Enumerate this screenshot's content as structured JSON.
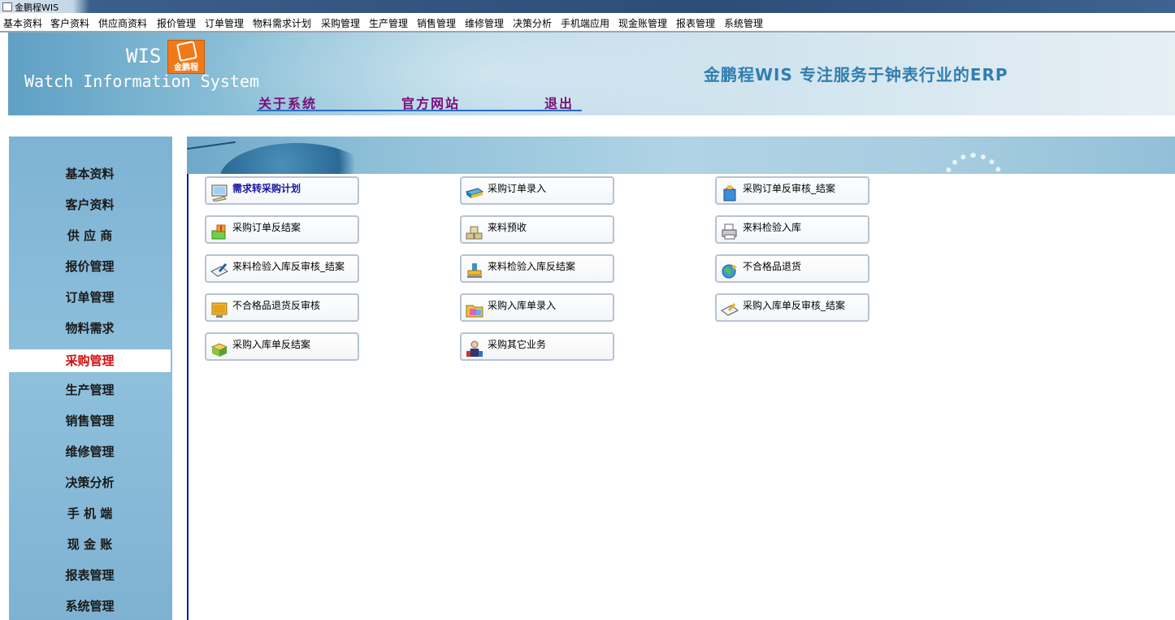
{
  "window": {
    "title": "金鹏程WIS"
  },
  "menubar": [
    "基本资料",
    "客户资料",
    "供应商资料",
    "报价管理",
    "订单管理",
    "物料需求计划",
    "采购管理",
    "生产管理",
    "销售管理",
    "维修管理",
    "决策分析",
    "手机端应用",
    "现金账管理",
    "报表管理",
    "系统管理"
  ],
  "banner": {
    "wis": "WIS",
    "logo_text": "金鹏程",
    "system_name": "Watch Information System",
    "slogan": "金鹏程WIS  专注服务于钟表行业的ERP",
    "links": [
      "关于系统",
      "官方网站",
      "退出"
    ]
  },
  "sidebar": {
    "items": [
      "基本资料",
      "客户资料",
      "供 应 商",
      "报价管理",
      "订单管理",
      "物料需求",
      "采购管理",
      "生产管理",
      "销售管理",
      "维修管理",
      "决策分析",
      "手 机 端",
      "现 金 账",
      "报表管理",
      "系统管理"
    ],
    "active": "采购管理"
  },
  "functions": [
    {
      "label": "需求转采购计划",
      "icon": "monitor-plan-icon"
    },
    {
      "label": "采购订单录入",
      "icon": "laptop-order-icon"
    },
    {
      "label": "采购订单反审核_结案",
      "icon": "shopping-bag-icon"
    },
    {
      "label": "采购订单反结案",
      "icon": "gift-box-icon"
    },
    {
      "label": "来料预收",
      "icon": "stacked-boxes-icon"
    },
    {
      "label": "来料检验入库",
      "icon": "printer-icon"
    },
    {
      "label": "来料检验入库反审核_结案",
      "icon": "notebook-edit-icon"
    },
    {
      "label": "来料检验入库反结案",
      "icon": "stamp-icon"
    },
    {
      "label": "不合格品退货",
      "icon": "globe-return-icon"
    },
    {
      "label": "不合格品退货反审核",
      "icon": "monitor-edit-icon"
    },
    {
      "label": "采购入库单录入",
      "icon": "folder-docs-icon"
    },
    {
      "label": "采购入库单反审核_结案",
      "icon": "book-edit-icon"
    },
    {
      "label": "采购入库单反结案",
      "icon": "package-icon"
    },
    {
      "label": "采购其它业务",
      "icon": "users-group-icon"
    }
  ]
}
